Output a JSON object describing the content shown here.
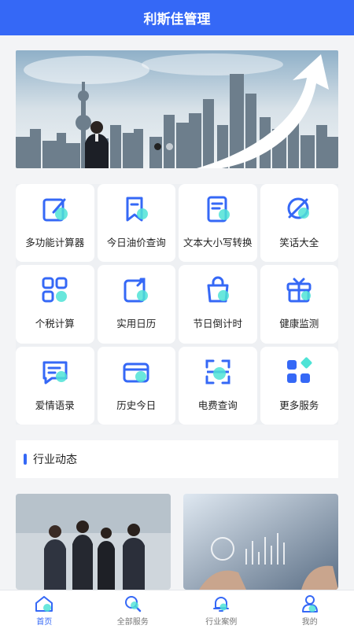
{
  "header": {
    "title": "利斯佳管理"
  },
  "banner": {
    "slides": 2,
    "active": 0
  },
  "services": [
    {
      "label": "多功能计算器",
      "icon": "edit-icon"
    },
    {
      "label": "今日油价查询",
      "icon": "bookmark-icon"
    },
    {
      "label": "文本大小写转换",
      "icon": "document-icon"
    },
    {
      "label": "笑话大全",
      "icon": "planet-icon"
    },
    {
      "label": "个税计算",
      "icon": "grid-icon"
    },
    {
      "label": "实用日历",
      "icon": "calendar-icon"
    },
    {
      "label": "节日倒计时",
      "icon": "bag-icon"
    },
    {
      "label": "健康监测",
      "icon": "gift-icon"
    },
    {
      "label": "爱情语录",
      "icon": "message-icon"
    },
    {
      "label": "历史今日",
      "icon": "wallet-icon"
    },
    {
      "label": "电费查询",
      "icon": "scan-icon"
    },
    {
      "label": "更多服务",
      "icon": "more-icon"
    }
  ],
  "section": {
    "title": "行业动态"
  },
  "tabbar": [
    {
      "label": "首页",
      "icon": "home-icon",
      "active": true
    },
    {
      "label": "全部服务",
      "icon": "search-icon",
      "active": false
    },
    {
      "label": "行业案例",
      "icon": "bell-icon",
      "active": false
    },
    {
      "label": "我的",
      "icon": "user-icon",
      "active": false
    }
  ],
  "colors": {
    "primary": "#3568f6",
    "accent": "#4fe3d6"
  }
}
